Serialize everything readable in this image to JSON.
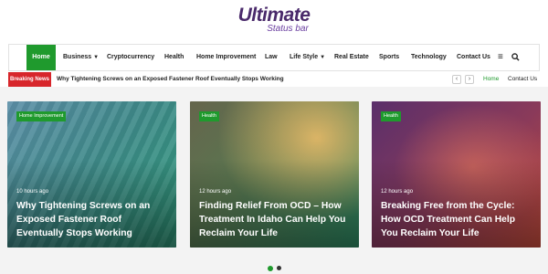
{
  "logo": {
    "main": "Ultimate",
    "sub": "Status bar"
  },
  "nav": {
    "items": [
      {
        "label": "Home",
        "active": true
      },
      {
        "label": "Business",
        "dropdown": true
      },
      {
        "label": "Cryptocurrency"
      },
      {
        "label": "Health"
      },
      {
        "label": "Home Improvement"
      },
      {
        "label": "Law"
      },
      {
        "label": "Life Style",
        "dropdown": true
      },
      {
        "label": "Real Estate"
      },
      {
        "label": "Sports"
      },
      {
        "label": "Technology"
      },
      {
        "label": "Contact Us"
      }
    ],
    "icons": [
      "menu-icon",
      "search-icon"
    ]
  },
  "breaking": {
    "label": "Breaking News",
    "headline": "Why Tightening Screws on an Exposed Fastener Roof Eventually Stops Working",
    "prev": "‹",
    "next": "›",
    "links": [
      "Home",
      "Contact Us"
    ]
  },
  "cards": [
    {
      "tag": "Home Improvement",
      "time": "10 hours ago",
      "title": "Why Tightening Screws on an Exposed Fastener Roof Eventually Stops Working"
    },
    {
      "tag": "Health",
      "time": "12 hours ago",
      "title": "Finding Relief From OCD – How Treatment In Idaho Can Help You Reclaim Your Life"
    },
    {
      "tag": "Health",
      "time": "12 hours ago",
      "title": "Breaking Free from the Cycle: How OCD Treatment Can Help You Reclaim Your Life"
    }
  ],
  "colors": {
    "accent": "#1f9a2d",
    "breaking": "#d7262b",
    "brand": "#6b3fa0"
  }
}
